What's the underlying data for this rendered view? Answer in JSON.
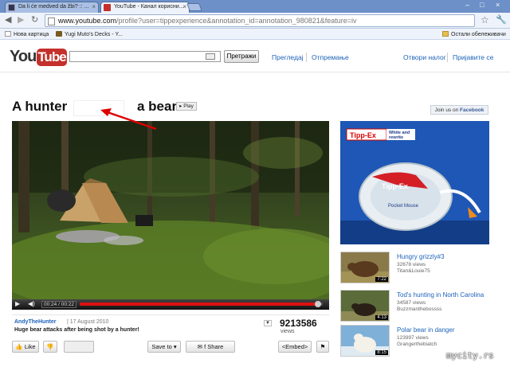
{
  "browser": {
    "tabs": [
      {
        "label": "Da li će medved da žbi? :: ...",
        "close": "×"
      },
      {
        "label": "YouTube - Канал корисни...",
        "close": "×"
      }
    ],
    "window_controls": {
      "minimize": "–",
      "maximize": "□",
      "close": "×"
    },
    "url_host": "www.youtube.com",
    "url_path": "/profile?user=tippexperience&annotation_id=annotation_980821&feature=iv",
    "bookmarks": [
      "Нова картица",
      "Yugi Muto's Decks - Y..."
    ],
    "other_bookmarks": "Остали обележивачи"
  },
  "header": {
    "logo_you": "You",
    "logo_tube": "Tube",
    "search_button": "Претражи",
    "links": [
      "Прегледај",
      "Отпремање"
    ],
    "account_links": [
      "Отвори налог",
      "Пријавите се"
    ]
  },
  "video": {
    "title_left": "A hunter",
    "title_right": "a bear",
    "play_label": "Play",
    "join_prefix": "Join us on ",
    "join_brand": "Facebook",
    "time": "00:24 / 00:22",
    "progress": 0.98,
    "uploader": "AndyTheHunter",
    "date": "17 August 2010",
    "description": "Huge bear attacks after being shot by a hunter!",
    "views": "9213586",
    "views_label": "views",
    "actions": {
      "like": "Like",
      "save_to": "Save to",
      "share": "Share",
      "embed": "<Embed>"
    }
  },
  "ad": {
    "brand": "Tipp-Ex",
    "tagline_1": "White and",
    "tagline_2": "rewrite",
    "product": "Tipp-Ex",
    "product_sub": "Pocket Mouse"
  },
  "related": [
    {
      "title": "Hungry grizzly#3",
      "views": "32678 views",
      "user": "Titan&Louie75",
      "duration": "7:22"
    },
    {
      "title": "Tod's hunting in North Carolina",
      "views": "34587 views",
      "user": "Buzzmanthebossss",
      "duration": "4:13"
    },
    {
      "title": "Polar bear in danger",
      "views": "123997 views",
      "user": "Grangerthebiatch",
      "duration": "8:15"
    }
  ],
  "watermark": "mycity.rs",
  "colors": {
    "youtube_red": "#c4302b",
    "link_blue": "#1c62b9",
    "progress_red": "#dd1111"
  }
}
